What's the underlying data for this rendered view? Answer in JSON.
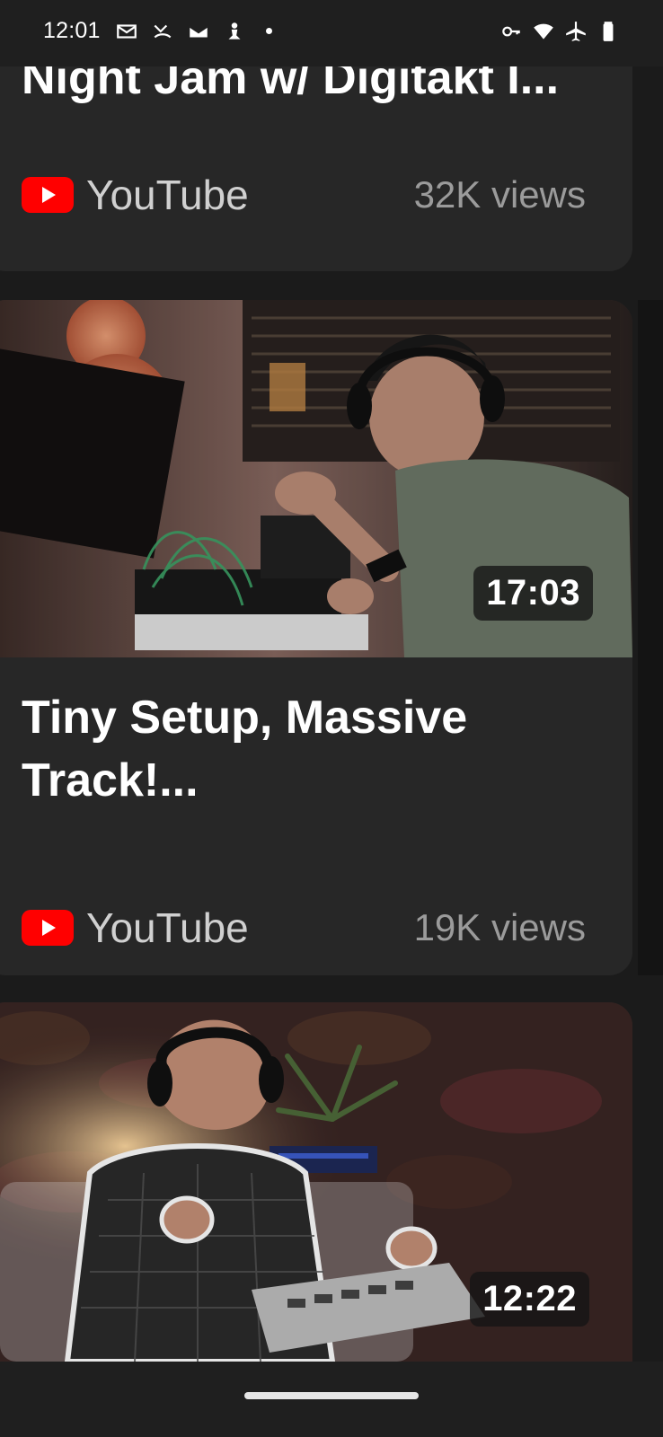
{
  "status_bar": {
    "time": "12:01",
    "left_icons": [
      "mail-icon",
      "missed-call-icon",
      "gmail-icon",
      "chess-icon",
      "notification-dot-icon"
    ],
    "right_icons": [
      "vpn-key-icon",
      "wifi-icon",
      "airplane-icon",
      "battery-icon"
    ]
  },
  "feed": {
    "cards": [
      {
        "title": "Night Jam w/ Digitakt I...",
        "source": "YouTube",
        "views": "32K views"
      },
      {
        "title": "Tiny Setup, Massive Track!...",
        "duration": "17:03",
        "source": "YouTube",
        "views": "19K views"
      },
      {
        "duration": "12:22"
      }
    ]
  },
  "colors": {
    "background": "#1b1b1b",
    "card": "#272727",
    "youtube_red": "#ff0000",
    "text_primary": "#ffffff",
    "text_secondary": "#9b9b9b"
  }
}
